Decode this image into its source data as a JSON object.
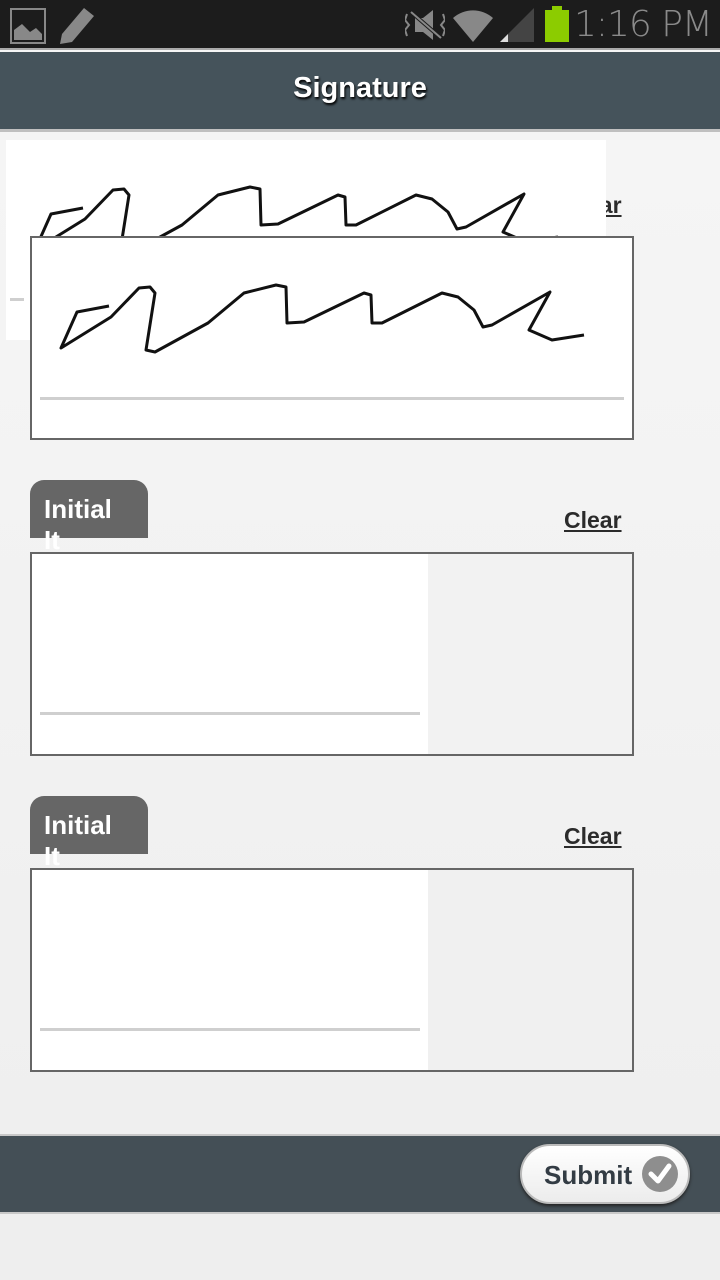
{
  "status_bar": {
    "time": "1:16 PM",
    "icons": [
      "gallery-icon",
      "pencil-icon",
      "vibrate-mute-icon",
      "wifi-icon",
      "signal-icon",
      "battery-icon"
    ],
    "battery_color": "#8ccc00"
  },
  "header": {
    "title": "Signature"
  },
  "sections": [
    {
      "clear_label": "Clear",
      "has_signature": true
    },
    {
      "tab_label": "Initial It",
      "clear_label": "Clear"
    },
    {
      "tab_label": "Initial It",
      "clear_label": "Clear"
    }
  ],
  "footer": {
    "submit_label": "Submit"
  }
}
